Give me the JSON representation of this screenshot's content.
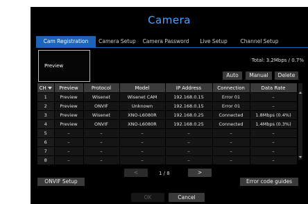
{
  "window": {
    "title": "Camera"
  },
  "tabs": [
    {
      "label": "Cam Registration",
      "active": true
    },
    {
      "label": "Camera Setup",
      "active": false
    },
    {
      "label": "Camera Password",
      "active": false
    },
    {
      "label": "Live Setup",
      "active": false
    },
    {
      "label": "Channel Setup",
      "active": false
    }
  ],
  "preview": {
    "label": "Preview"
  },
  "total": "Total: 3.2Mbps / 0.7%",
  "actions": {
    "auto": "Auto",
    "manual": "Manual",
    "delete": "Delete"
  },
  "table": {
    "headers": {
      "ch": "CH",
      "preview": "Preview",
      "protocol": "Protocol",
      "model": "Model",
      "ip": "IP Address",
      "connection": "Connection",
      "rate": "Data Rate"
    },
    "rows": [
      {
        "ch": "1",
        "preview": "Preview",
        "protocol": "Wisenet",
        "model": "Wisenet CAM",
        "ip": "192.168.0.15",
        "connection": "Error 01",
        "rate": "–"
      },
      {
        "ch": "2",
        "preview": "Preview",
        "protocol": "ONVIF",
        "model": "Unknown",
        "ip": "192.168.0.15",
        "connection": "Error 01",
        "rate": "–"
      },
      {
        "ch": "3",
        "preview": "Preview",
        "protocol": "Wisenet",
        "model": "XNO-L6080R",
        "ip": "192.168.0.25",
        "connection": "Connected",
        "rate": "1.8Mbps (0.4%)"
      },
      {
        "ch": "4",
        "preview": "Preview",
        "protocol": "ONVIF",
        "model": "XNO-L6080R",
        "ip": "192.168.0.25",
        "connection": "Connected",
        "rate": "1.4Mbps (0.3%)"
      },
      {
        "ch": "5",
        "preview": "–",
        "protocol": "–",
        "model": "–",
        "ip": "–",
        "connection": "–",
        "rate": "–"
      },
      {
        "ch": "6",
        "preview": "–",
        "protocol": "–",
        "model": "–",
        "ip": "–",
        "connection": "–",
        "rate": "–"
      },
      {
        "ch": "7",
        "preview": "–",
        "protocol": "–",
        "model": "–",
        "ip": "–",
        "connection": "–",
        "rate": "–"
      },
      {
        "ch": "8",
        "preview": "–",
        "protocol": "–",
        "model": "–",
        "ip": "–",
        "connection": "–",
        "rate": "–"
      }
    ]
  },
  "pagination": {
    "prev": "<",
    "text": "1 / 8",
    "next": ">"
  },
  "footer": {
    "onvif": "ONVIF Setup",
    "errors": "Error code guides",
    "ok": "OK",
    "cancel": "Cancel"
  }
}
